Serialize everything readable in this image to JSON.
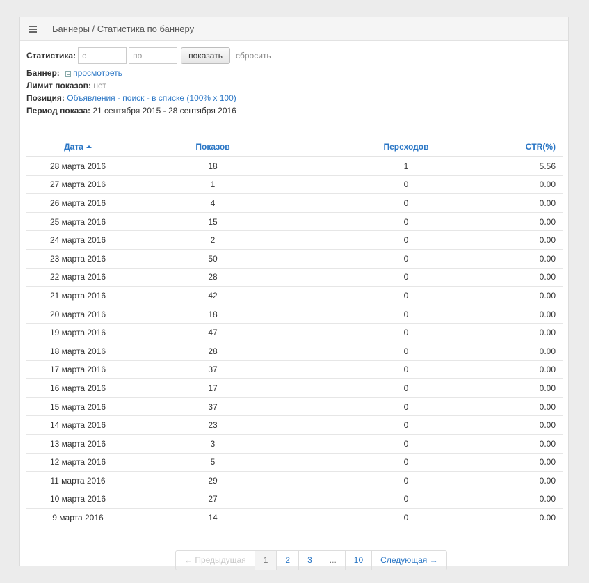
{
  "header": {
    "breadcrumb": "Баннеры / Статистика по баннеру",
    "menu_icon": "hamburger-icon"
  },
  "filter": {
    "label": "Статистика:",
    "from_placeholder": "с",
    "to_placeholder": "по",
    "show_button": "показать",
    "reset_link": "сбросить"
  },
  "info": {
    "banner_label": "Баннер:",
    "banner_link": "просмотреть",
    "limit_label": "Лимит показов:",
    "limit_value": "нет",
    "position_label": "Позиция:",
    "position_value": "Объявления - поиск - в списке (100% x 100)",
    "period_label": "Период показа:",
    "period_value": "21 сентября 2015 - 28 сентября 2016"
  },
  "table": {
    "columns": [
      "Дата",
      "Показов",
      "Переходов",
      "CTR(%)"
    ],
    "rows": [
      [
        "28 марта 2016",
        "18",
        "1",
        "5.56"
      ],
      [
        "27 марта 2016",
        "1",
        "0",
        "0.00"
      ],
      [
        "26 марта 2016",
        "4",
        "0",
        "0.00"
      ],
      [
        "25 марта 2016",
        "15",
        "0",
        "0.00"
      ],
      [
        "24 марта 2016",
        "2",
        "0",
        "0.00"
      ],
      [
        "23 марта 2016",
        "50",
        "0",
        "0.00"
      ],
      [
        "22 марта 2016",
        "28",
        "0",
        "0.00"
      ],
      [
        "21 марта 2016",
        "42",
        "0",
        "0.00"
      ],
      [
        "20 марта 2016",
        "18",
        "0",
        "0.00"
      ],
      [
        "19 марта 2016",
        "47",
        "0",
        "0.00"
      ],
      [
        "18 марта 2016",
        "28",
        "0",
        "0.00"
      ],
      [
        "17 марта 2016",
        "37",
        "0",
        "0.00"
      ],
      [
        "16 марта 2016",
        "17",
        "0",
        "0.00"
      ],
      [
        "15 марта 2016",
        "37",
        "0",
        "0.00"
      ],
      [
        "14 марта 2016",
        "23",
        "0",
        "0.00"
      ],
      [
        "13 марта 2016",
        "3",
        "0",
        "0.00"
      ],
      [
        "12 марта 2016",
        "5",
        "0",
        "0.00"
      ],
      [
        "11 марта 2016",
        "29",
        "0",
        "0.00"
      ],
      [
        "10 марта 2016",
        "27",
        "0",
        "0.00"
      ],
      [
        "9 марта 2016",
        "14",
        "0",
        "0.00"
      ]
    ]
  },
  "pagination": {
    "prev": "← Предыдущая",
    "pages": [
      "1",
      "2",
      "3",
      "...",
      "10"
    ],
    "active_page": "1",
    "next": "Следующая →"
  },
  "colors": {
    "link": "#2a76c5",
    "background": "#ececec"
  }
}
